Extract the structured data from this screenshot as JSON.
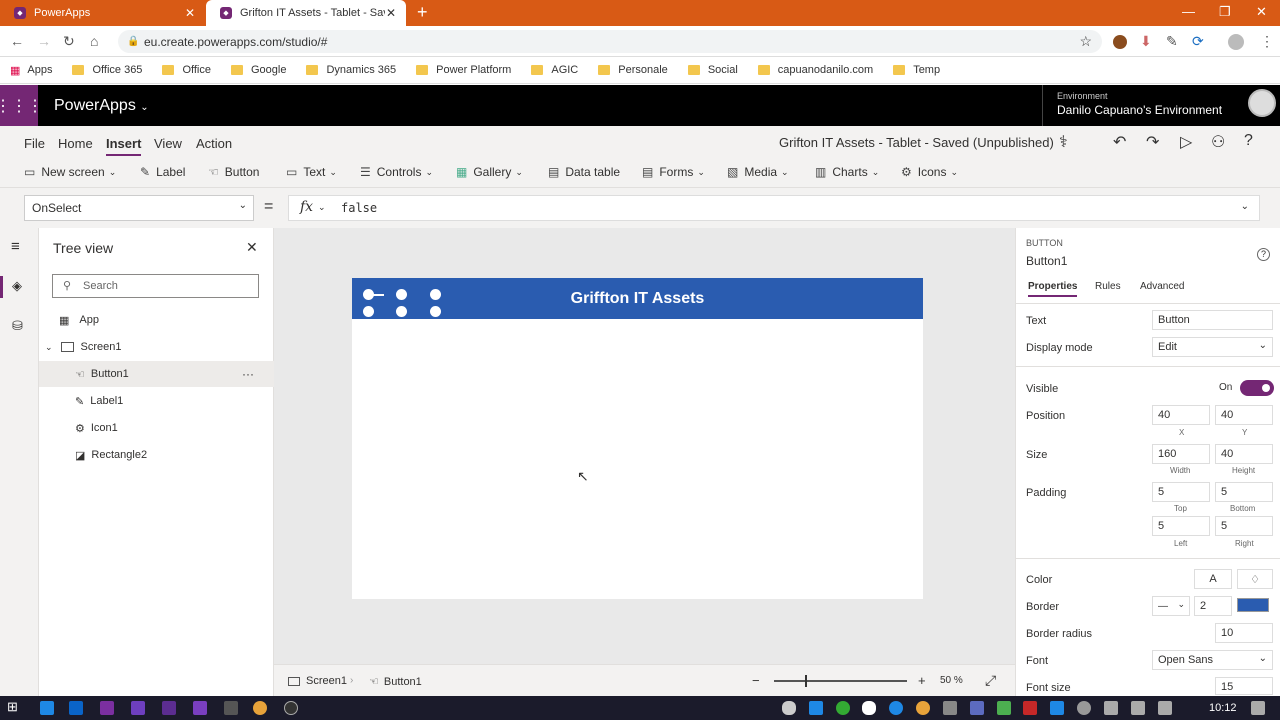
{
  "browser": {
    "tabs": [
      {
        "title": "PowerApps"
      },
      {
        "title": "Grifton IT Assets - Tablet - Saved"
      }
    ],
    "url": "eu.create.powerapps.com/studio/#",
    "bookmarks": [
      "Apps",
      "Office 365",
      "Office",
      "Google",
      "Dynamics 365",
      "Power Platform",
      "AGIC",
      "Personale",
      "Social",
      "capuanodanilo.com",
      "Temp"
    ]
  },
  "header": {
    "brand": "PowerApps",
    "env_label": "Environment",
    "env_name": "Danilo Capuano's Environment"
  },
  "menu": {
    "items": [
      "File",
      "Home",
      "Insert",
      "View",
      "Action"
    ],
    "app_title": "Grifton IT Assets - Tablet - Saved (Unpublished)"
  },
  "ribbon": {
    "items": [
      "New screen",
      "Label",
      "Button",
      "Text",
      "Controls",
      "Gallery",
      "Data table",
      "Forms",
      "Media",
      "Charts",
      "Icons"
    ]
  },
  "formula": {
    "property": "OnSelect",
    "fx": "fx",
    "value": "false"
  },
  "tree": {
    "title": "Tree view",
    "search_placeholder": "Search",
    "nodes": [
      "App",
      "Screen1",
      "Button1",
      "Label1",
      "Icon1",
      "Rectangle2"
    ]
  },
  "canvas": {
    "title": "Griffton IT Assets",
    "status_screen": "Screen1",
    "status_control": "Button1",
    "zoom": "50",
    "zoom_unit": "%"
  },
  "props": {
    "type": "BUTTON",
    "name": "Button1",
    "tabs": [
      "Properties",
      "Rules",
      "Advanced"
    ],
    "text_label": "Text",
    "text_value": "Button",
    "display_label": "Display mode",
    "display_value": "Edit",
    "visible_label": "Visible",
    "visible_value": "On",
    "position_label": "Position",
    "pos_x": "40",
    "pos_y": "40",
    "x_label": "X",
    "y_label": "Y",
    "size_label": "Size",
    "width": "160",
    "height": "40",
    "width_label": "Width",
    "height_label": "Height",
    "padding_label": "Padding",
    "pad_top": "5",
    "pad_bottom": "5",
    "pad_left": "5",
    "pad_right": "5",
    "top_label": "Top",
    "bottom_label": "Bottom",
    "left_label": "Left",
    "right_label": "Right",
    "color_label": "Color",
    "color_a": "A",
    "border_label": "Border",
    "border_width": "2",
    "radius_label": "Border radius",
    "radius_value": "10",
    "font_label": "Font",
    "font_value": "Open Sans",
    "fontsize_label": "Font size",
    "fontsize_value": "15"
  },
  "taskbar": {
    "time": "10:12"
  },
  "colors": {
    "accent": "#742774",
    "titlebar": "#2a5cb0",
    "chrome": "#d85a15"
  }
}
